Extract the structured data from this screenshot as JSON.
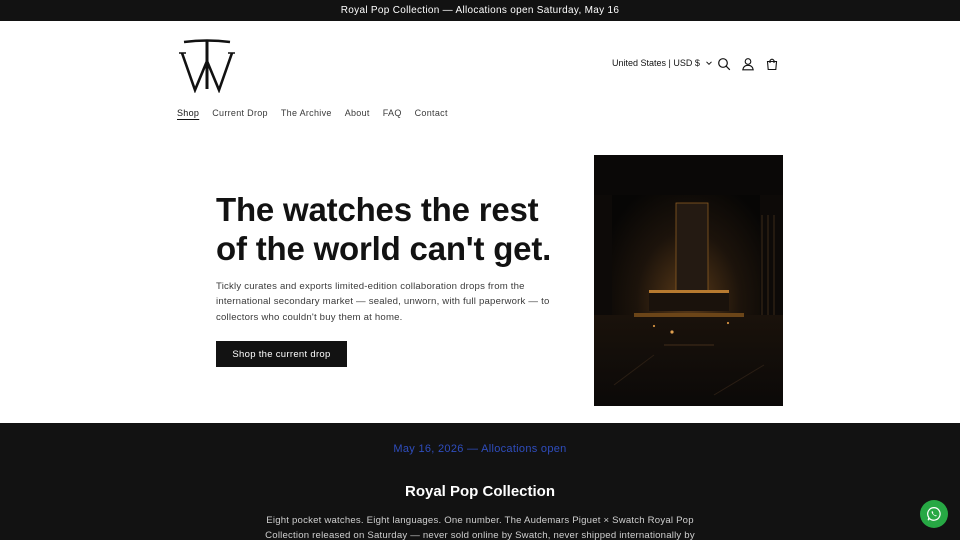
{
  "announcement": "Royal Pop Collection — Allocations open Saturday, May 16",
  "header": {
    "logo_letters": "TW",
    "locale": "United States | USD $",
    "icons": [
      "search-icon",
      "account-icon",
      "cart-icon"
    ]
  },
  "nav": {
    "items": [
      {
        "label": "Shop",
        "active": true
      },
      {
        "label": "Current Drop"
      },
      {
        "label": "The Archive"
      },
      {
        "label": "About"
      },
      {
        "label": "FAQ"
      },
      {
        "label": "Contact"
      }
    ]
  },
  "hero": {
    "title": "The watches the rest of the world can't get.",
    "description": "Tickly curates and exports limited-edition collaboration drops from the international secondary market — sealed, unworn, with full paperwork — to collectors who couldn't buy them at home.",
    "button": "Shop the current drop"
  },
  "collection": {
    "date_line": "May 16, 2026 — Allocations open",
    "title": "Royal Pop Collection",
    "description": "Eight pocket watches. Eight languages. One number. The Audemars Piguet × Swatch Royal Pop Collection released on Saturday — never sold online by Swatch, never shipped internationally by"
  },
  "colors": {
    "dark": "#121212",
    "accent_link": "#2f4dbd",
    "whatsapp": "#27a844"
  }
}
